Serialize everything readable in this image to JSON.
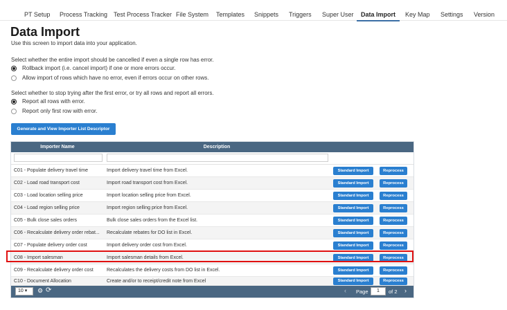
{
  "tabs": [
    {
      "label": "PT Setup"
    },
    {
      "label": "Process Tracking"
    },
    {
      "label": "Test Process Tracker"
    },
    {
      "label": "File System"
    },
    {
      "label": "Templates"
    },
    {
      "label": "Snippets"
    },
    {
      "label": "Triggers"
    },
    {
      "label": "Super User"
    },
    {
      "label": "Data Import",
      "active": true
    },
    {
      "label": "Key Map"
    },
    {
      "label": "Settings"
    },
    {
      "label": "Version"
    }
  ],
  "page": {
    "title": "Data Import",
    "subtitle": "Use this screen to import data into your application."
  },
  "error_mode": {
    "question": "Select whether the entire import should be cancelled if even a single row has error.",
    "options": [
      {
        "label": "Rollback import (i.e. cancel import) if one or more errors occur.",
        "checked": true
      },
      {
        "label": "Allow import of rows which have no error, even if errors occur on other rows.",
        "checked": false
      }
    ]
  },
  "report_mode": {
    "question": "Select whether to stop trying after the first error, or try all rows and report all errors.",
    "options": [
      {
        "label": "Report all rows with error.",
        "checked": true
      },
      {
        "label": "Report only first row with error.",
        "checked": false
      }
    ]
  },
  "generate_button": "Generate and View Importer List Descriptor",
  "grid": {
    "columns": [
      "Importer Name",
      "Description"
    ],
    "standard_label": "Standard Import",
    "reprocess_label": "Reprocess",
    "rows": [
      {
        "name": "C01 - Populate delivery travel time",
        "description": "Import delivery travel time from Excel."
      },
      {
        "name": "C02 - Load road transport cost",
        "description": "Import road transport cost from Excel."
      },
      {
        "name": "C03 - Load location selling price",
        "description": "Import location selling price from Excel."
      },
      {
        "name": "C04 - Load region selling price",
        "description": "Import region selling price from Excel."
      },
      {
        "name": "C05 - Bulk close sales orders",
        "description": "Bulk close sales orders from the Excel list."
      },
      {
        "name": "C06 - Recalculate delivery order rebat...",
        "description": "Recalculate rebates for DO list in Excel."
      },
      {
        "name": "C07 - Populate delivery order cost",
        "description": "Import delivery order cost from Excel."
      },
      {
        "name": "C08 - Import salesman",
        "description": "Import salesman details from Excel.",
        "highlighted": true
      },
      {
        "name": "C09 - Recalculate delivery order cost",
        "description": "Recalculates the delivery costs from DO list in Excel."
      },
      {
        "name": "C10 - Document Allocation",
        "description": "Create and/or to receipt/credit note from Excel"
      }
    ]
  },
  "pager": {
    "page_size": "10",
    "page_label": "Page",
    "current_page": "1",
    "of_label": "of 2"
  },
  "icons": {
    "prev": "chevron-left-icon",
    "next": "chevron-right-icon",
    "settings": "gear-icon",
    "refresh": "refresh-icon"
  },
  "colors": {
    "header_bg": "#4a6782",
    "button_bg": "#2a7fd0",
    "highlight": "#e01010",
    "active_tab_underline": "#3a6ea5"
  }
}
